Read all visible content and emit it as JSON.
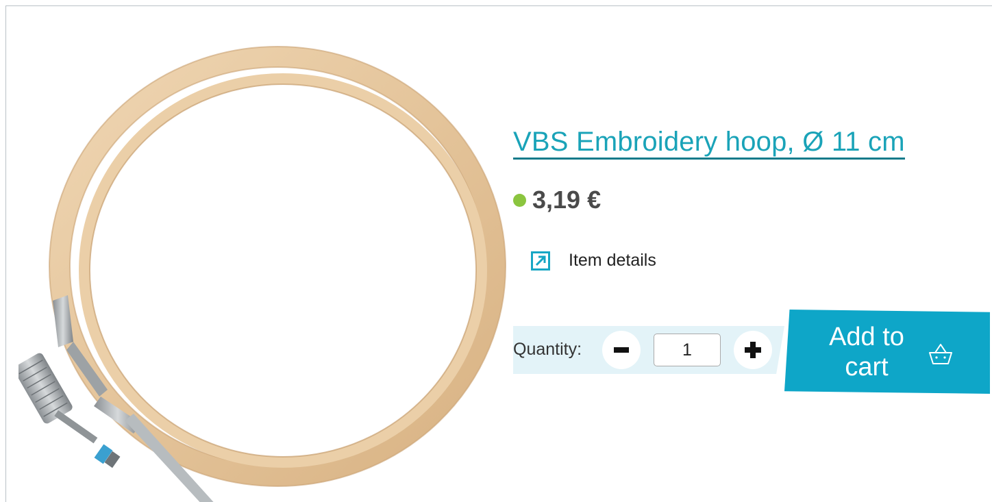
{
  "product": {
    "title": "VBS Embroidery hoop, Ø 11 cm",
    "price": "3,19 €",
    "stock_color": "#8bc53f",
    "details_label": "Item details",
    "details_icon": "external-link-arrow-icon",
    "image_alt": "bamboo-embroidery-hoop-image"
  },
  "cart": {
    "quantity_label": "Quantity:",
    "quantity_value": "1",
    "minus_icon": "minus-icon",
    "plus_icon": "plus-icon",
    "add_label": "Add to cart",
    "basket_icon": "basket-icon",
    "accent_color": "#0ea6c8"
  }
}
